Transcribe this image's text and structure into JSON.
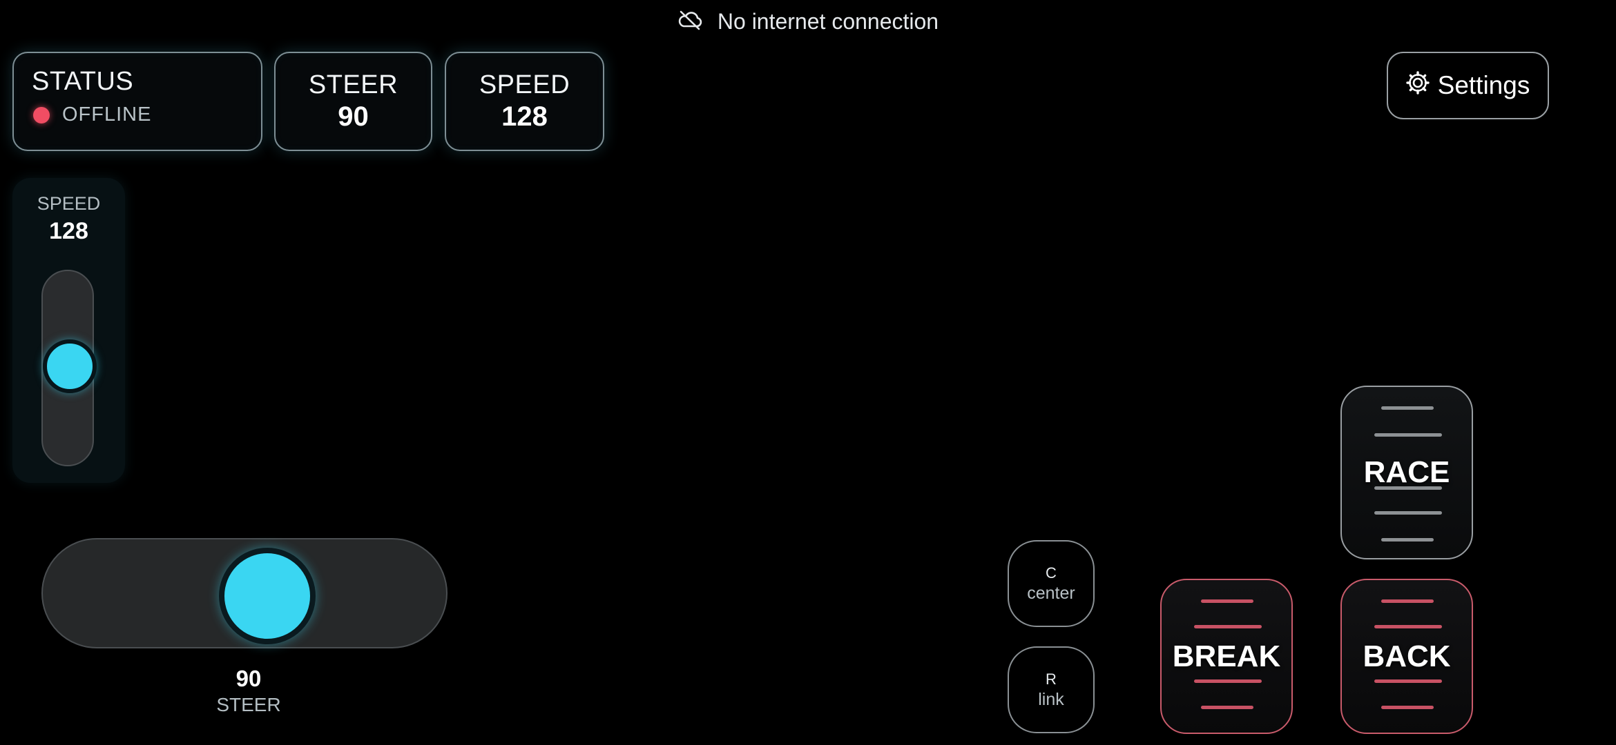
{
  "banner": {
    "icon": "cloud-off-icon",
    "text": "No internet connection"
  },
  "status_card": {
    "label": "STATUS",
    "state": "OFFLINE",
    "state_color": "#f04d63"
  },
  "steer_card": {
    "label": "STEER",
    "value": "90"
  },
  "speed_card": {
    "label": "SPEED",
    "value": "128"
  },
  "settings": {
    "icon": "gear-icon",
    "label": "Settings"
  },
  "speed_slider": {
    "label": "SPEED",
    "value": "128",
    "level": 0.5
  },
  "steer_slider": {
    "label": "STEER",
    "value": "90",
    "level": 0.5
  },
  "keys": [
    {
      "key": "C",
      "label": "center"
    },
    {
      "key": "R",
      "label": "link"
    }
  ],
  "pedals": {
    "race": "RACE",
    "break": "BREAK",
    "back": "BACK"
  },
  "colors": {
    "accent": "#3ad6f2",
    "danger": "#c85264",
    "background": "#000000"
  }
}
